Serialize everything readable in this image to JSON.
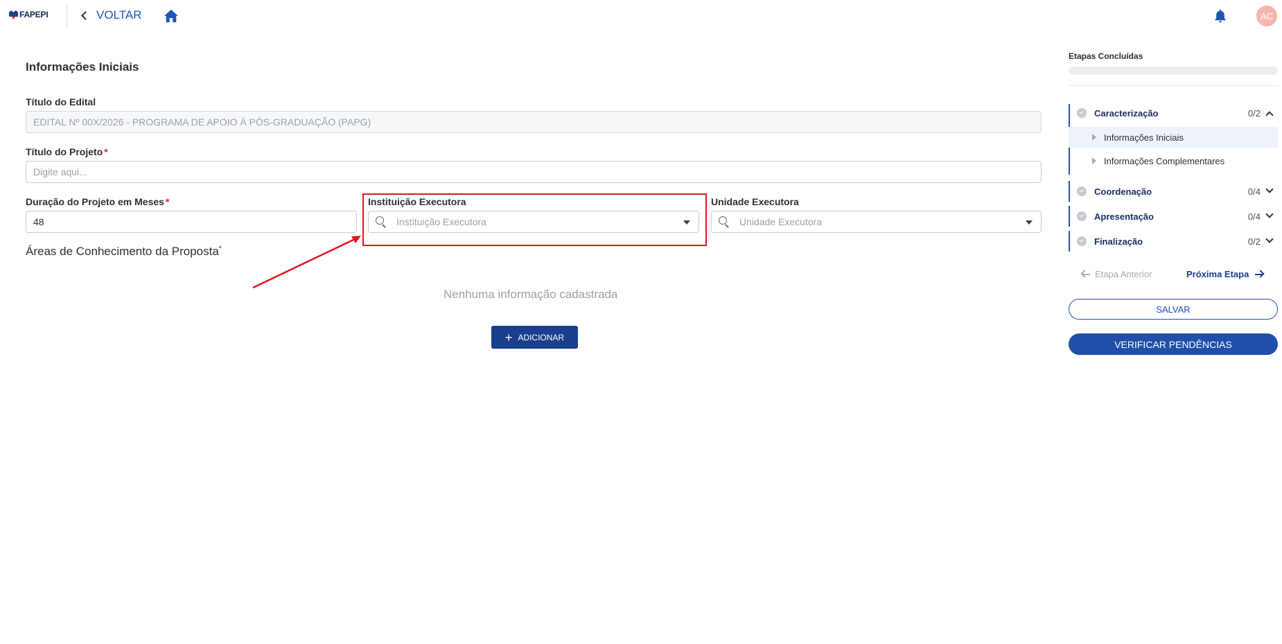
{
  "header": {
    "logo_text": "FAPEPI",
    "back_label": "VOLTAR",
    "avatar_initials": "AC"
  },
  "form": {
    "section_title": "Informações Iniciais",
    "edital": {
      "label": "Título do Edital",
      "value": "EDITAL Nº 00X/2026 - PROGRAMA DE APOIO À PÓS-GRADUAÇÃO (PAPG)"
    },
    "projeto": {
      "label": "Título do Projeto",
      "required_mark": "*",
      "placeholder": "Digite aqui..."
    },
    "duracao": {
      "label": "Duração do Projeto em Meses",
      "required_mark": "*",
      "value": "48"
    },
    "instituicao": {
      "label": "Instituição Executora",
      "placeholder": "Instituição Executora"
    },
    "unidade": {
      "label": "Unidade Executora",
      "placeholder": "Unidade Executora"
    },
    "areas": {
      "title": "Áreas de Conhecimento da Proposta",
      "required_mark": "*",
      "empty_message": "Nenhuma informação cadastrada",
      "add_label": "ADICIONAR"
    }
  },
  "sidebar": {
    "title": "Etapas Concluídas",
    "progress": 0,
    "steps": [
      {
        "name": "Caracterização",
        "count": "0/2",
        "expanded": true
      },
      {
        "name": "Coordenação",
        "count": "0/4",
        "expanded": false
      },
      {
        "name": "Apresentação",
        "count": "0/4",
        "expanded": false
      },
      {
        "name": "Finalização",
        "count": "0/2",
        "expanded": false
      }
    ],
    "substeps": [
      {
        "name": "Informações Iniciais",
        "active": true
      },
      {
        "name": "Informações Complementares",
        "active": false
      }
    ],
    "prev_label": "Etapa Anterior",
    "next_label": "Próxima Etapa",
    "save_label": "SALVAR",
    "verify_label": "VERIFICAR PENDÊNCIAS"
  },
  "colors": {
    "primary": "#1f4fa8",
    "dark_button": "#1a3f8c",
    "highlight": "#e3141b",
    "avatar_bg": "#f7b5b0"
  }
}
